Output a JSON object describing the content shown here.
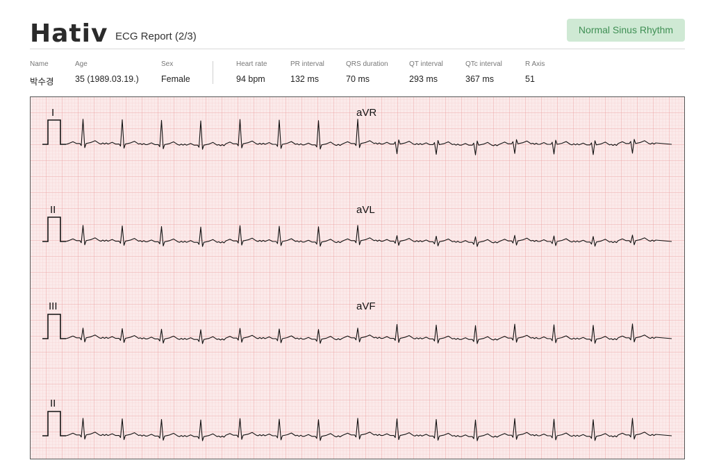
{
  "header": {
    "logo": "Hativ",
    "report_title": "ECG Report (2/3)",
    "rhythm_badge": "Normal Sinus Rhythm"
  },
  "patient": {
    "name_label": "Name",
    "name": "박수경",
    "age_label": "Age",
    "age": "35 (1989.03.19.)",
    "sex_label": "Sex",
    "sex": "Female"
  },
  "measurements": [
    {
      "label": "Heart rate",
      "value": "94 bpm"
    },
    {
      "label": "PR interval",
      "value": "132 ms"
    },
    {
      "label": "QRS duration",
      "value": "70 ms"
    },
    {
      "label": "QT interval",
      "value": "293 ms"
    },
    {
      "label": "QTc interval",
      "value": "367 ms"
    },
    {
      "label": "R Axis",
      "value": "51"
    }
  ],
  "leads": {
    "row1_left": "I",
    "row1_right": "aVR",
    "row2_left": "II",
    "row2_right": "aVL",
    "row3_left": "III",
    "row3_right": "aVF",
    "row4_left": "II"
  },
  "colors": {
    "grid_bg": "#fbeaea",
    "grid_minor": "#f3c6c6",
    "grid_major": "#eb9c9c",
    "trace": "#111111",
    "badge_bg": "#cfe9d4",
    "badge_text": "#3f8f54"
  }
}
